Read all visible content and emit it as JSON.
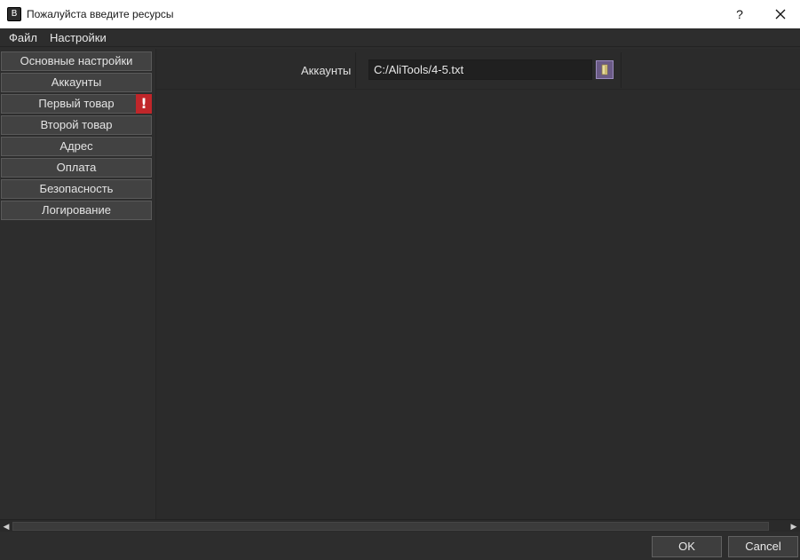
{
  "window": {
    "title": "Пожалуйста введите ресурсы",
    "icon": "app-icon",
    "help_glyph": "?",
    "close_icon": "close-icon"
  },
  "menu": [
    "Файл",
    "Настройки"
  ],
  "sidebar": {
    "items": [
      {
        "label": "Основные настройки"
      },
      {
        "label": "Аккаунты"
      },
      {
        "label": "Первый товар",
        "warning": "!"
      },
      {
        "label": "Второй товар"
      },
      {
        "label": "Адрес"
      },
      {
        "label": "Оплата"
      },
      {
        "label": "Безопасность"
      },
      {
        "label": "Логирование"
      }
    ]
  },
  "form": {
    "accounts_label": "Аккаунты",
    "accounts_path": "C:/AliTools/4-5.txt",
    "browse_icon": "folder-icon"
  },
  "buttons": {
    "ok": "OK",
    "cancel": "Cancel"
  },
  "colors": {
    "warning": "#c0262a",
    "browse_accent": "#6a5a86"
  }
}
